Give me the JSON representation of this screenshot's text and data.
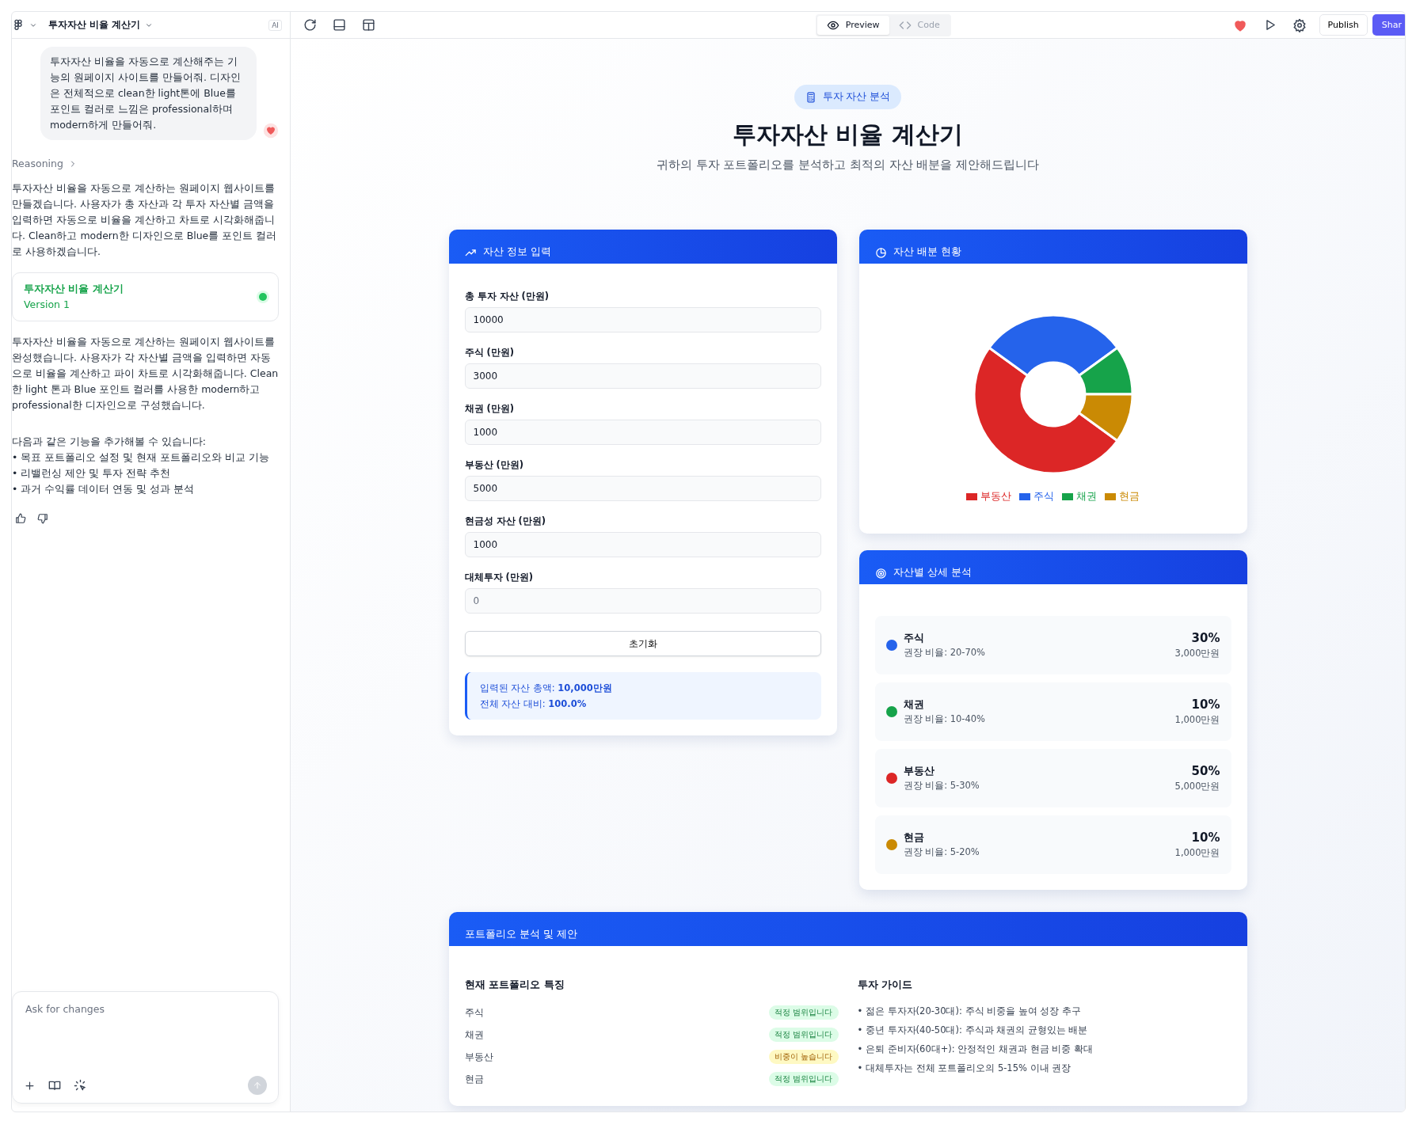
{
  "top_bar": {
    "project_title": "투자자산 비율 계산기",
    "ai_badge": "AI",
    "view_tabs": [
      {
        "label": "Preview",
        "kind": "preview",
        "selected": true
      },
      {
        "label": "Code",
        "kind": "code",
        "selected": false
      }
    ],
    "publish": "Publish",
    "share": "Shar"
  },
  "chat": {
    "user_message": "투자자산 비율을 자동으로 계산해주는 기능의 원페이지 사이트를 만들어줘. 디자인은 전체적으로 clean한 light톤에 Blue를 포인트 컬러로 느낌은 professional하며 modern하게 만들어줘.",
    "reasoning": "Reasoning",
    "reply_intro": "투자자산 비율을 자동으로 계산하는 원페이지 웹사이트를 만들겠습니다. 사용자가 총 자산과 각 투자 자산별 금액을 입력하면 자동으로 비율을 계산하고 차트로 시각화해줍니다. Clean하고 modern한 디자인으로 Blue를 포인트 컬러로 사용하겠습니다.",
    "artifact": {
      "title": "투자자산 비율 계산기",
      "version": "Version 1",
      "active": true
    },
    "reply_summary": "투자자산 비율을 자동으로 계산하는 원페이지 웹사이트를 완성했습니다. 사용자가 각 자산별 금액을 입력하면 자동으로 비율을 계산하고 파이 차트로 시각화해줍니다. Clean한 light 톤과 Blue 포인트 컬러를 사용한 modern하고 professional한 디자인으로 구성했습니다.",
    "suggestions_intro": "다음과 같은 기능을 추가해볼 수 있습니다:",
    "suggestions": [
      "• 목표 포트폴리오 설정 및 현재 포트폴리오와 비교 기능",
      "• 리밸런싱 제안 및 투자 전략 추천",
      "• 과거 수익률 데이터 연동 및 성과 분석"
    ],
    "composer": {
      "placeholder": "Ask for changes"
    }
  },
  "hero": {
    "badge": "투자 자산 분석",
    "title": "투자자산 비율 계산기",
    "subtitle": "귀하의 투자 포트폴리오를 분석하고 최적의 자산 배분을 제안해드립니다"
  },
  "input_card": {
    "title": "자산 정보 입력",
    "fields": [
      {
        "label": "총 투자 자산 (만원)",
        "value": "10000"
      },
      {
        "label": "주식 (만원)",
        "value": "3000"
      },
      {
        "label": "채권 (만원)",
        "value": "1000"
      },
      {
        "label": "부동산 (만원)",
        "value": "5000"
      },
      {
        "label": "현금성 자산 (만원)",
        "value": "1000"
      },
      {
        "label": "대체투자 (만원)",
        "placeholder": "0"
      }
    ],
    "reset_button": "초기화",
    "summary": [
      "입력된 자산 총액: **10,000만원**",
      "전체 자산 대비: **100.0%**"
    ]
  },
  "chart_card": {
    "title": "자산 배분 현황",
    "chart_data": {
      "type": "donut",
      "categories": [
        "부동산",
        "주식",
        "채권",
        "현금"
      ],
      "values": [
        50,
        30,
        10,
        10
      ],
      "legend": "bottom",
      "colors": [
        "#dc2626",
        "#2563eb",
        "#16a34a",
        "#ca8a04"
      ]
    }
  },
  "detail_card": {
    "title": "자산별 상세 분석",
    "items": [
      {
        "name": "주식",
        "range": "권장 비율: 20-70%",
        "percent": "30%",
        "amount": "3,000만원",
        "color": "#2563eb"
      },
      {
        "name": "채권",
        "range": "권장 비율: 10-40%",
        "percent": "10%",
        "amount": "1,000만원",
        "color": "#16a34a"
      },
      {
        "name": "부동산",
        "range": "권장 비율: 5-30%",
        "percent": "50%",
        "amount": "5,000만원",
        "color": "#dc2626"
      },
      {
        "name": "현금",
        "range": "권장 비율: 5-20%",
        "percent": "10%",
        "amount": "1,000만원",
        "color": "#ca8a04"
      }
    ]
  },
  "analysis_card": {
    "title": "포트폴리오 분석 및 제안",
    "features_heading": "현재 포트폴리오 특징",
    "features": [
      {
        "asset": "주식",
        "status": "적정 범위입니다",
        "kind": "ok"
      },
      {
        "asset": "채권",
        "status": "적정 범위입니다",
        "kind": "ok"
      },
      {
        "asset": "부동산",
        "status": "비중이 높습니다",
        "kind": "high"
      },
      {
        "asset": "현금",
        "status": "적정 범위입니다",
        "kind": "ok"
      }
    ],
    "guide_heading": "투자 가이드",
    "guide": [
      "• 젊은 투자자(20-30대): 주식 비중을 높여 성장 추구",
      "• 중년 투자자(40-50대): 주식과 채권의 균형있는 배분",
      "• 은퇴 준비자(60대+): 안정적인 채권과 현금 비중 확대",
      "• 대체투자는 전체 포트폴리오의 5-15% 이내 권장"
    ]
  }
}
